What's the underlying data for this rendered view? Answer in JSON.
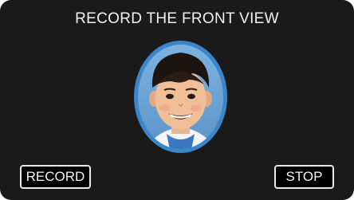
{
  "header": {
    "title": "RECORD THE FRONT VIEW"
  },
  "frame": {
    "ring_color": "#3a86c8",
    "subject_icon": "face-photo"
  },
  "buttons": {
    "record_label": "RECORD",
    "stop_label": "STOP"
  }
}
